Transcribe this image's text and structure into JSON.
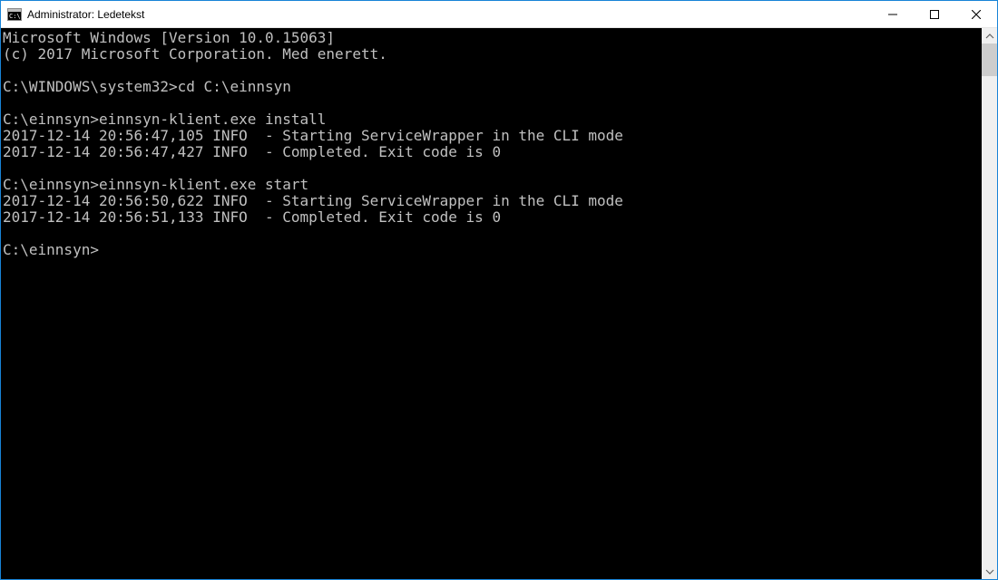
{
  "window": {
    "title": "Administrator: Ledetekst"
  },
  "terminal": {
    "lines": [
      "Microsoft Windows [Version 10.0.15063]",
      "(c) 2017 Microsoft Corporation. Med enerett.",
      "",
      "C:\\WINDOWS\\system32>cd C:\\einnsyn",
      "",
      "C:\\einnsyn>einnsyn-klient.exe install",
      "2017-12-14 20:56:47,105 INFO  - Starting ServiceWrapper in the CLI mode",
      "2017-12-14 20:56:47,427 INFO  - Completed. Exit code is 0",
      "",
      "C:\\einnsyn>einnsyn-klient.exe start",
      "2017-12-14 20:56:50,622 INFO  - Starting ServiceWrapper in the CLI mode",
      "2017-12-14 20:56:51,133 INFO  - Completed. Exit code is 0",
      "",
      "C:\\einnsyn>"
    ]
  }
}
